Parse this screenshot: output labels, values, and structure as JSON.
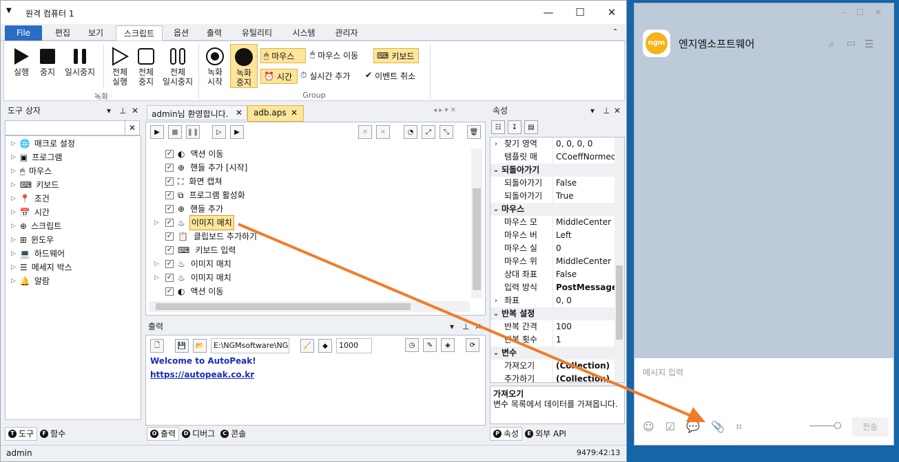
{
  "window": {
    "title": "원격 컴퓨터 1"
  },
  "menu": {
    "items": [
      "File",
      "편집",
      "보기",
      "스크립트",
      "옵션",
      "출력",
      "유틸리티",
      "시스템",
      "관리자"
    ]
  },
  "ribbon": {
    "run": "실행",
    "stop": "중지",
    "pause": "일시중지",
    "all_run": [
      "전체",
      "실행"
    ],
    "all_stop": [
      "전체",
      "중지"
    ],
    "all_pause": [
      "전체",
      "일시중지"
    ],
    "rec_start": [
      "녹화",
      "시작"
    ],
    "rec_stop": [
      "녹화",
      "중지"
    ],
    "mouse": "마우스",
    "mouse_move": "마우스 이동",
    "keyboard": "키보드",
    "time": "시간",
    "realtime_add": "실시간 추가",
    "event_cancel": "이벤트 취소",
    "group_record": "녹화",
    "group_group": "Group"
  },
  "toolbox": {
    "title": "도구 상자",
    "items": [
      "매크로 설정",
      "프로그램",
      "마우스",
      "키보드",
      "조건",
      "시간",
      "스크립트",
      "윈도우",
      "하드웨어",
      "메세지 박스",
      "알람"
    ]
  },
  "tabs": {
    "t1": "admin님 환영합니다.",
    "t2": "adb.aps"
  },
  "script": {
    "rows": [
      {
        "label": "액션 이동",
        "expand": false
      },
      {
        "label": "핸들 추가 [시작]",
        "expand": false
      },
      {
        "label": "화면 캡쳐",
        "expand": false
      },
      {
        "label": "프로그램 활성화",
        "expand": false
      },
      {
        "label": "핸들 추가",
        "expand": false
      },
      {
        "label": "이미지 매치",
        "expand": true
      },
      {
        "label": "클립보드 추가하기",
        "expand": false
      },
      {
        "label": "키보드 입력",
        "expand": false
      },
      {
        "label": "이미지 매치",
        "expand": true
      },
      {
        "label": "이미지 매치",
        "expand": true
      },
      {
        "label": "액션 이동",
        "expand": false
      }
    ]
  },
  "output": {
    "title": "출력",
    "path": "E:\\NGMsoftware\\NG",
    "count": "1000",
    "welcome": "Welcome to AutoPeak!",
    "link": "https://autopeak.co.kr"
  },
  "properties": {
    "title": "속성",
    "rows": [
      {
        "type": "row",
        "arrow": ">",
        "k": "찾기 영역",
        "v": "0, 0, 0, 0"
      },
      {
        "type": "row",
        "k": "템플릿 매",
        "v": "CCoeffNormed"
      },
      {
        "type": "cat",
        "k": "되돌아가기"
      },
      {
        "type": "row",
        "k": "되돌아가기",
        "v": "False"
      },
      {
        "type": "row",
        "k": "되돌아가기",
        "v": "True"
      },
      {
        "type": "cat",
        "k": "마우스"
      },
      {
        "type": "row",
        "k": "마우스 모",
        "v": "MiddleCenter"
      },
      {
        "type": "row",
        "k": "마우스 버",
        "v": "Left"
      },
      {
        "type": "row",
        "k": "마우스 실",
        "v": "0"
      },
      {
        "type": "row",
        "k": "마우스 위",
        "v": "MiddleCenter"
      },
      {
        "type": "row",
        "k": "상대 좌표",
        "v": "False"
      },
      {
        "type": "row",
        "k": "입력 방식",
        "v": "PostMessage",
        "bold": true
      },
      {
        "type": "row",
        "arrow": ">",
        "k": "좌표",
        "v": "0, 0"
      },
      {
        "type": "cat",
        "k": "반복 설정"
      },
      {
        "type": "row",
        "k": "반복 간격",
        "v": "100"
      },
      {
        "type": "row",
        "k": "반복 횟수",
        "v": "1"
      },
      {
        "type": "cat",
        "k": "변수"
      },
      {
        "type": "row",
        "k": "가져오기",
        "v": "(Collection)",
        "bold": true
      },
      {
        "type": "row",
        "k": "추가하기",
        "v": "(Collection)",
        "bold": true
      }
    ],
    "desc_title": "가져오기",
    "desc_text": "변수 목록에서 데이터를 가져옵니다."
  },
  "bottom_tabs": {
    "left": [
      "도구",
      "함수"
    ],
    "left_letters": [
      "T",
      "F"
    ],
    "mid": [
      "출력",
      "디버그",
      "콘솔"
    ],
    "mid_letters": [
      "O",
      "D",
      "C"
    ],
    "right": [
      "속성",
      "외부 API"
    ],
    "right_letters": [
      "P",
      "E"
    ]
  },
  "status": {
    "user": "admin",
    "time": "9479:42:13"
  },
  "chat": {
    "name": "엔지엠소프트웨어",
    "logo": "ngm",
    "placeholder": "메시지 입력",
    "send": "전송"
  },
  "colors": {
    "accent": "#2b6cc4",
    "highlight": "#fde59b",
    "arrow": "#f07c28",
    "chat_bg": "#bccad9"
  }
}
